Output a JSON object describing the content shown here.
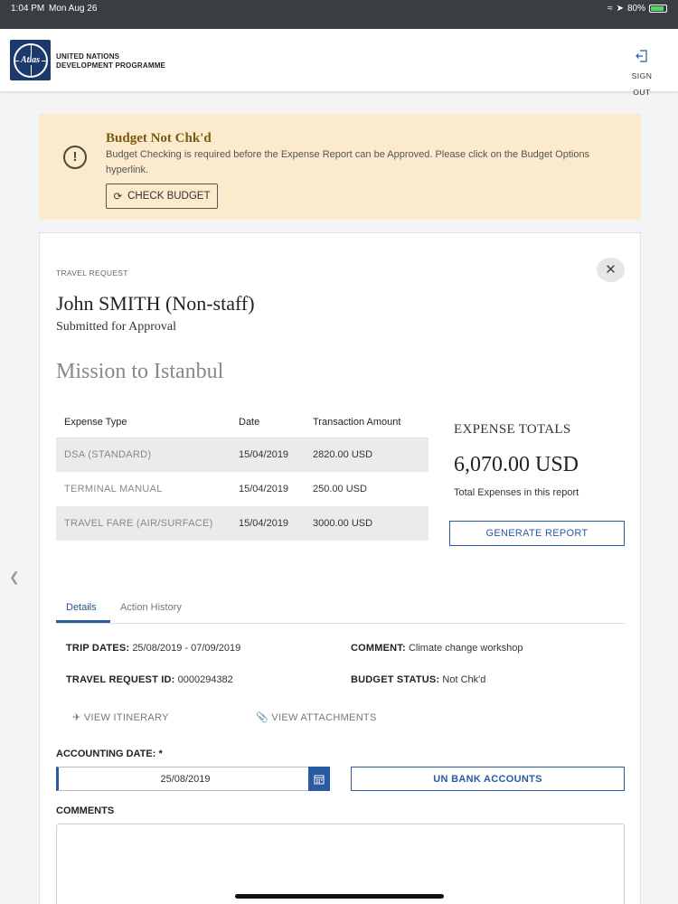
{
  "status_bar": {
    "time": "1:04 PM",
    "date": "Mon Aug 26",
    "battery": "80%"
  },
  "header": {
    "logo_text": "Atlas",
    "org_line1": "UNITED NATIONS",
    "org_line2": "DEVELOPMENT PROGRAMME",
    "signout_label": "SIGN OUT"
  },
  "alert": {
    "title": "Budget Not Chk'd",
    "message": "Budget Checking is required before the Expense Report can be Approved. Please click on the Budget Options hyperlink.",
    "button_label": "CHECK BUDGET",
    "icon": "exclamation-circle-icon",
    "background": "#fbeacc"
  },
  "request": {
    "section_label": "TRAVEL REQUEST",
    "person": "John SMITH (Non-staff)",
    "status": "Submitted for Approval",
    "title": "Mission to Istanbul"
  },
  "expenses": {
    "columns": [
      "Expense Type",
      "Date",
      "Transaction Amount"
    ],
    "rows": [
      {
        "type": "DSA (STANDARD)",
        "date": "15/04/2019",
        "amount": "2820.00 USD"
      },
      {
        "type": "TERMINAL MANUAL",
        "date": "15/04/2019",
        "amount": "250.00 USD"
      },
      {
        "type": "TRAVEL FARE (AIR/SURFACE)",
        "date": "15/04/2019",
        "amount": "3000.00 USD"
      }
    ]
  },
  "totals": {
    "title": "EXPENSE TOTALS",
    "amount": "6,070.00 USD",
    "subtitle": "Total Expenses in this report",
    "generate_label": "GENERATE REPORT"
  },
  "tabs": [
    {
      "label": "Details",
      "active": true
    },
    {
      "label": "Action History",
      "active": false
    }
  ],
  "details": {
    "trip_dates_label": "TRIP DATES:",
    "trip_dates": "25/08/2019 - 07/09/2019",
    "comment_label": "COMMENT:",
    "comment": "Climate change workshop",
    "tr_id_label": "TRAVEL REQUEST ID:",
    "tr_id": "0000294382",
    "budget_status_label": "BUDGET STATUS:",
    "budget_status": "Not Chk'd",
    "view_itinerary": "VIEW ITINERARY",
    "view_attachments": "VIEW ATTACHMENTS"
  },
  "accounting": {
    "label": "ACCOUNTING DATE: *",
    "value": "25/08/2019",
    "bank_button": "UN BANK ACCOUNTS"
  },
  "comments": {
    "label": "COMMENTS",
    "value": ""
  },
  "colors": {
    "accent": "#2a5aa0",
    "header_dark": "#3a3d42"
  }
}
